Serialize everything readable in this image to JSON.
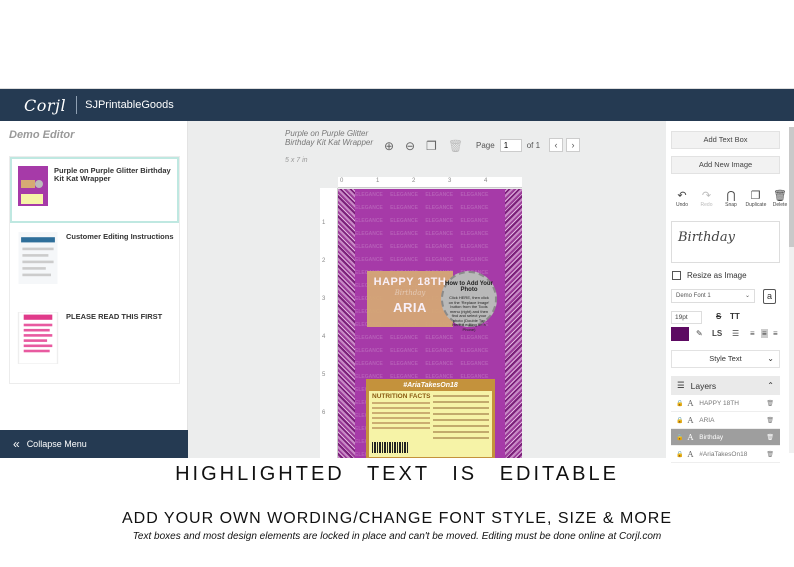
{
  "app": {
    "logo": "Corjl",
    "brand": "SJPrintableGoods"
  },
  "left": {
    "title": "Demo Editor",
    "pages": [
      {
        "label": "Purple on Purple Glitter Birthday Kit Kat Wrapper"
      },
      {
        "label": "Customer Editing Instructions"
      },
      {
        "label": "PLEASE READ THIS FIRST"
      }
    ],
    "collapse_label": "Collapse Menu"
  },
  "center": {
    "doc_title": "Purple on Purple Glitter Birthday Kit Kat Wrapper",
    "doc_size": "5 x 7 in",
    "page_label": "Page",
    "page_value": "1",
    "page_of": "of 1",
    "ruler_h": [
      "0",
      "1",
      "2",
      "3",
      "4"
    ],
    "ruler_v": [
      "1",
      "2",
      "3",
      "4",
      "5",
      "6"
    ],
    "design": {
      "happy": "HAPPY 18TH",
      "birthday": "Birthday",
      "aria": "ARIA",
      "howto_title": "How to Add Your Photo",
      "howto_body": "Click HERE, then click on the 'Replace Image' button from the Tools menu (right) and then find and select your photo (Double Tap Here if editing on a Phone)",
      "hashtag": "#AriaTakesOn18",
      "nutrition_title": "NUTRITION FACTS",
      "bg_word": "ELEGANCE"
    }
  },
  "right": {
    "add_text": "Add Text Box",
    "add_image": "Add New Image",
    "tools": [
      {
        "icon": "↶",
        "label": "Undo"
      },
      {
        "icon": "↷",
        "label": "Redo"
      },
      {
        "icon": "⋂",
        "label": "Snap"
      },
      {
        "icon": "❐",
        "label": "Duplicate"
      },
      {
        "icon": "🗑",
        "label": "Delete"
      }
    ],
    "preview_text": "Birthday",
    "resize_label": "Resize as Image",
    "font_value": "Demo Font 1",
    "size_value": "19pt",
    "text_color": "#5d0a62",
    "style_text": "Style Text",
    "layers_title": "Layers",
    "layers": [
      {
        "name": "HAPPY 18TH",
        "selected": false
      },
      {
        "name": "ARIA",
        "selected": false
      },
      {
        "name": "Birthday",
        "selected": true
      },
      {
        "name": "#AriaTakesOn18",
        "selected": false
      }
    ]
  },
  "captions": {
    "line1": "HIGHLIGHTED TEXT IS EDITABLE",
    "line2": "ADD YOUR OWN WORDING/CHANGE FONT STYLE, SIZE & MORE",
    "line3": "Text boxes and most design elements are locked in place and can't be moved. Editing must be done online at Corjl.com"
  },
  "colors": {
    "topbar": "#253a52",
    "canvas_purple": "#a63aa8",
    "label_gold": "#d6aa74",
    "nutrition_yellow": "#f6f3a7"
  }
}
